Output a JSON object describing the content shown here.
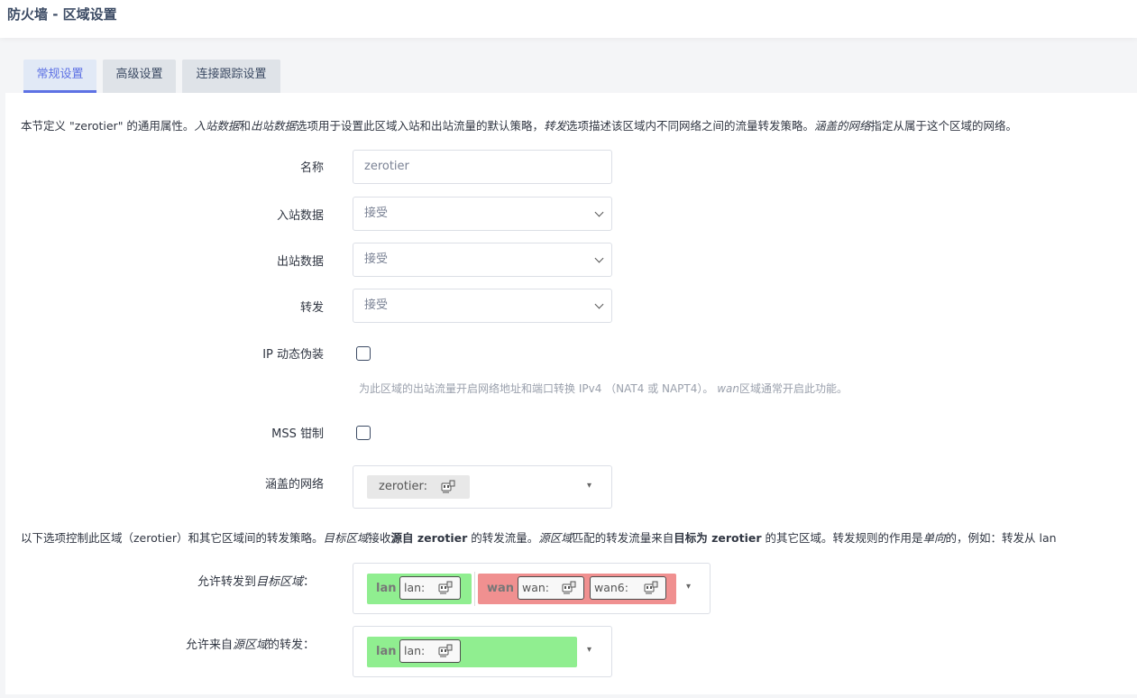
{
  "header": {
    "title": "防火墙 - 区域设置"
  },
  "tabs": [
    {
      "label": "常规设置",
      "active": true
    },
    {
      "label": "高级设置",
      "active": false
    },
    {
      "label": "连接跟踪设置",
      "active": false
    }
  ],
  "description": {
    "p1": "本节定义 \"zerotier\" 的通用属性。",
    "em1": "入站数据",
    "p2": "和",
    "em2": "出站数据",
    "p3": "选项用于设置此区域入站和出站流量的默认策略，",
    "em3": "转发",
    "p4": "选项描述该区域内不同网络之间的流量转发策略。",
    "em4": "涵盖的网络",
    "p5": "指定从属于这个区域的网络。"
  },
  "form": {
    "name": {
      "label": "名称",
      "placeholder": "zerotier"
    },
    "input": {
      "label": "入站数据",
      "value": "接受"
    },
    "output": {
      "label": "出站数据",
      "value": "接受"
    },
    "forward": {
      "label": "转发",
      "value": "接受"
    },
    "masq": {
      "label": "IP 动态伪装",
      "hint_a": "为此区域的出站流量开启网络地址和端口转换 IPv4 （NAT4 或 NAPT4）。",
      "hint_em": "wan",
      "hint_b": "区域通常开启此功能。"
    },
    "mss": {
      "label": "MSS 钳制"
    },
    "networks": {
      "label": "涵盖的网络",
      "tag": "zerotier:"
    }
  },
  "forwarding_desc": {
    "p1": "以下选项控制此区域（zerotier）和其它区域间的转发策略。",
    "em1": "目标区域",
    "p2": "接收",
    "b1": "源自 zerotier",
    "p3": " 的转发流量。",
    "em2": "源区域",
    "p4": "匹配的转发流量来自",
    "b2": "目标为 zerotier",
    "p5": " 的其它区域。转发规则的作用是",
    "em3": "单向",
    "p6": "的，例如：转发从 lan"
  },
  "forward_to": {
    "label_a": "允许转发到",
    "label_em": "目标区域",
    "label_b": "：",
    "zones": [
      {
        "name": "lan",
        "color": "#90ee90",
        "nets": [
          "lan:"
        ]
      },
      {
        "name": "wan",
        "color": "#f09090",
        "nets": [
          "wan:",
          "wan6:"
        ]
      }
    ]
  },
  "forward_from": {
    "label_a": "允许来自",
    "label_em": "源区域",
    "label_b": "的转发：",
    "zones": [
      {
        "name": "lan",
        "color": "#90ee90",
        "nets": [
          "lan:"
        ]
      }
    ]
  },
  "icons": {
    "dropdown_caret": "▾",
    "network": "ethernet-port-icon"
  }
}
